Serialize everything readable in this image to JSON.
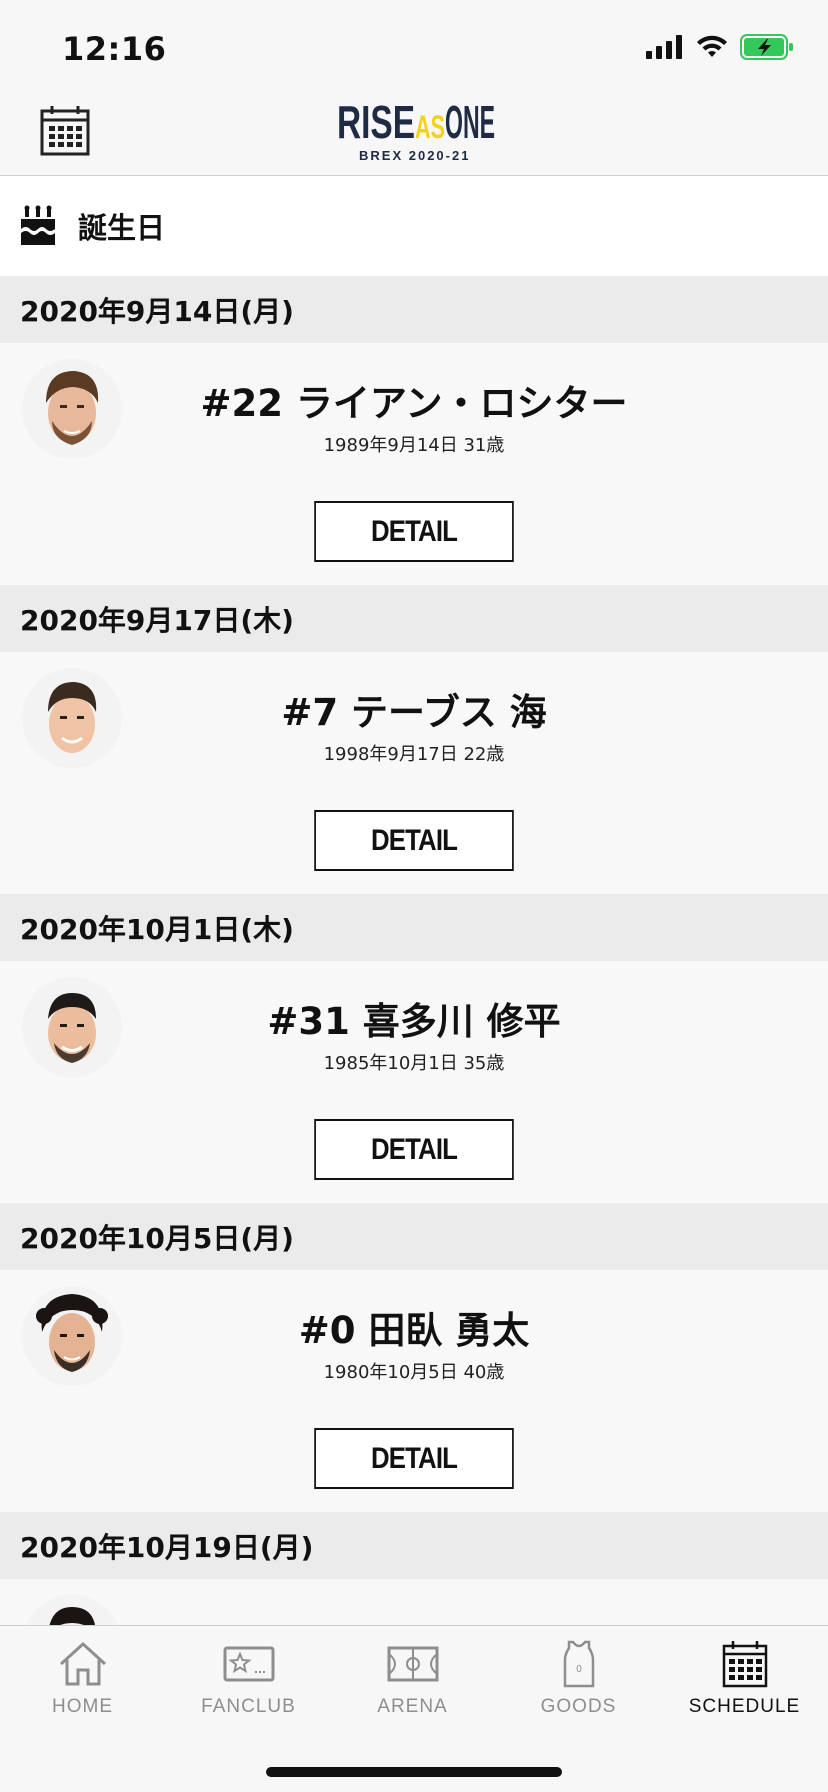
{
  "status_bar": {
    "time": "12:16"
  },
  "header": {
    "logo_line1_a": "RISE",
    "logo_line1_b": "AS",
    "logo_line1_c": "ONE",
    "logo_line2": "BREX 2020-21"
  },
  "section": {
    "title": "誕生日"
  },
  "birthdays": [
    {
      "date": "2020年9月14日(月)",
      "name": "#22 ライアン・ロシター",
      "birth": "1989年9月14日 31歳",
      "detail_label": "DETAIL"
    },
    {
      "date": "2020年9月17日(木)",
      "name": "#7 テーブス 海",
      "birth": "1998年9月17日 22歳",
      "detail_label": "DETAIL"
    },
    {
      "date": "2020年10月1日(木)",
      "name": "#31 喜多川 修平",
      "birth": "1985年10月1日 35歳",
      "detail_label": "DETAIL"
    },
    {
      "date": "2020年10月5日(月)",
      "name": "#0 田臥 勇太",
      "birth": "1980年10月5日 40歳",
      "detail_label": "DETAIL"
    },
    {
      "date": "2020年10月19日(月)",
      "name": "",
      "birth": "",
      "detail_label": ""
    }
  ],
  "tabs": [
    {
      "label": "HOME",
      "icon": "home-icon",
      "active": false
    },
    {
      "label": "FANCLUB",
      "icon": "fanclub-card-icon",
      "active": false
    },
    {
      "label": "ARENA",
      "icon": "basketball-court-icon",
      "active": false
    },
    {
      "label": "GOODS",
      "icon": "jersey-icon",
      "active": false
    },
    {
      "label": "SCHEDULE",
      "icon": "calendar-icon",
      "active": true
    }
  ],
  "colors": {
    "brand_navy": "#1f2a44",
    "brand_yellow": "#f2d31c",
    "battery_green": "#34c759"
  }
}
